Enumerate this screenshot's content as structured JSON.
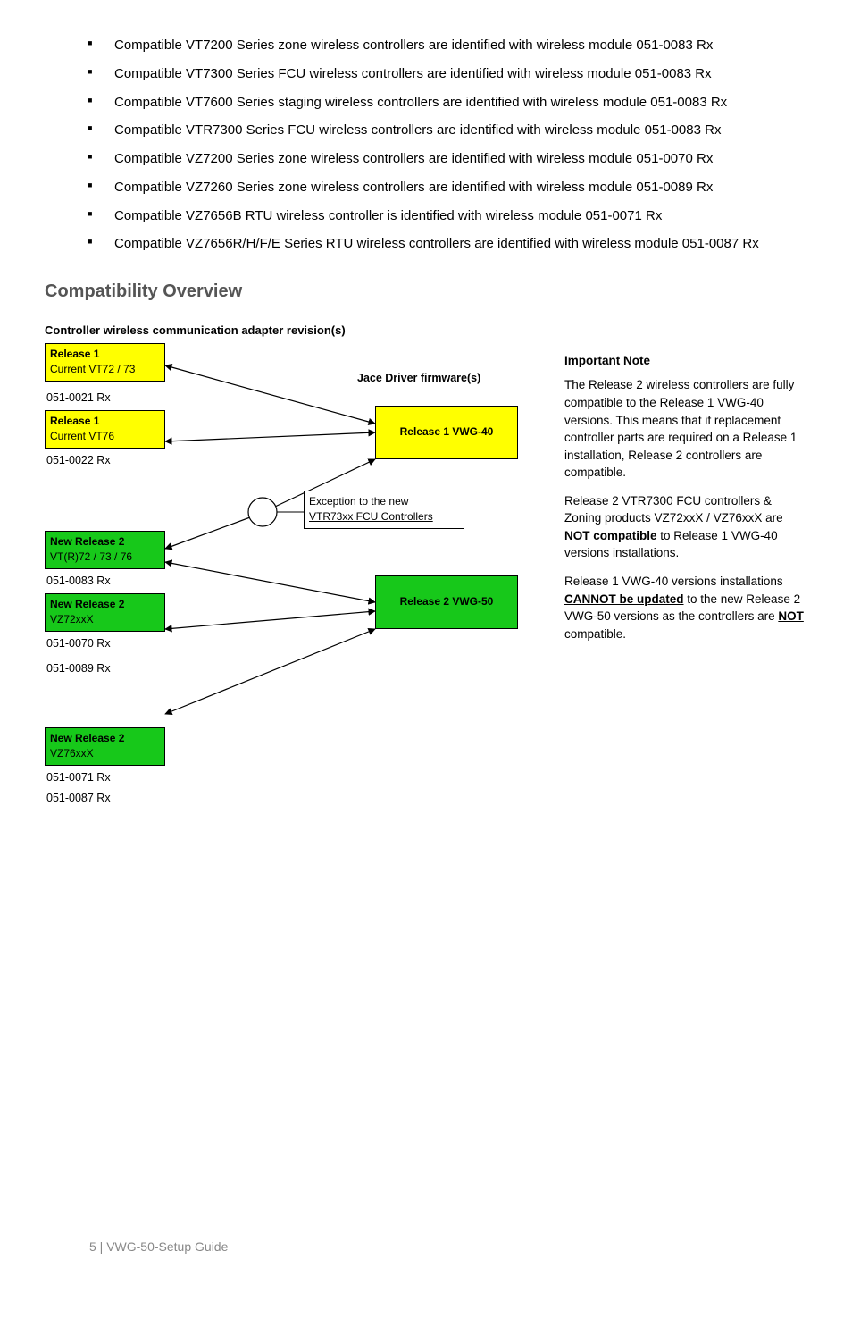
{
  "bullets": [
    "Compatible VT7200 Series zone wireless controllers are identified with wireless module 051-0083 Rx",
    "Compatible VT7300 Series FCU wireless controllers are identified with wireless module 051-0083 Rx",
    "Compatible VT7600 Series staging wireless controllers are identified with wireless module 051-0083 Rx",
    "Compatible VTR7300 Series FCU wireless controllers are identified with wireless module 051-0083 Rx",
    "Compatible VZ7200 Series zone wireless controllers are identified with wireless module 051-0070 Rx",
    "Compatible VZ7260 Series zone wireless controllers are identified with wireless module 051-0089 Rx",
    "Compatible VZ7656B RTU wireless controller is identified with wireless module 051-0071 Rx",
    "Compatible VZ7656R/H/F/E Series RTU wireless controllers are identified with wireless module 051-0087 Rx"
  ],
  "section_heading": "Compatibility Overview",
  "diagram": {
    "title": "Controller wireless communication adapter revision(s)",
    "left": [
      {
        "hdr": "Release 1",
        "sub": "Current VT72 / 73",
        "rev": "051-0021 Rx",
        "bg": "yellow"
      },
      {
        "hdr": "Release 1",
        "sub": "Current VT76",
        "rev": "051-0022 Rx",
        "bg": "yellow"
      },
      {
        "hdr": "New Release 2",
        "sub": "VT(R)72 / 73 / 76",
        "rev": "051-0083 Rx",
        "bg": "green"
      },
      {
        "hdr": "New Release 2",
        "sub": "VZ72xxX",
        "rev": "051-0070 Rx",
        "bg": "green"
      },
      {
        "rev": "051-0089 Rx"
      },
      {
        "hdr": "New Release 2",
        "sub": "VZ76xxX",
        "rev": "051-0071 Rx",
        "bg": "green"
      },
      {
        "rev": "051-0087 Rx"
      }
    ],
    "right_label": "Jace Driver firmware(s)",
    "right_boxes": [
      {
        "txt": "Release 1 VWG-40",
        "bg": "yellow"
      },
      {
        "txt": "Release 2 VWG-50",
        "bg": "green"
      }
    ],
    "exception": {
      "line1": "Exception to the new",
      "line2": "VTR73xx FCU Controllers"
    }
  },
  "notes": {
    "title": "Important Note",
    "p1a": "The Release 2 wireless controllers are fully compatible to the Release 1 VWG-40 versions. This means that if replacement controller parts are required on a Release 1 installation, Release 2 controllers are compatible.",
    "p2a": "Release 2 VTR7300 FCU controllers & Zoning products VZ72xxX / VZ76xxX are ",
    "p2b": "NOT compatible",
    "p2c": " to Release 1 VWG-40 versions installations.",
    "p3a": "Release 1 VWG-40 versions installations ",
    "p3b": "CANNOT be updated",
    "p3c": " to the new Release 2 VWG-50 versions as the controllers are ",
    "p3d": "NOT",
    "p3e": " compatible."
  },
  "footer": "5 | VWG-50-Setup Guide"
}
